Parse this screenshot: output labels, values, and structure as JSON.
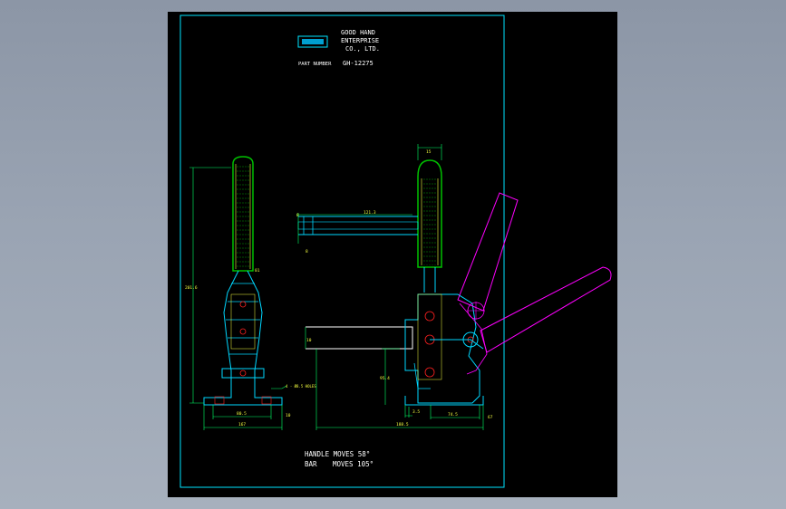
{
  "title_block": {
    "company_line1": "GOOD HAND",
    "company_line2": "ENTERPRISE",
    "company_line3": "CO., LTD.",
    "part_number_label": "PART NUMBER",
    "part_number": "GH-12275"
  },
  "dimensions": {
    "left_height": "201.6",
    "left_base_inner": "80.5",
    "left_base_outer": "167",
    "left_base_side": "10",
    "hole_note": "4 - Ø8.5 HOLES",
    "handle_width": "15",
    "bar_length": "121.3",
    "bar_left_top": "8",
    "bar_left_bottom": "8",
    "clamp_height": "95.4",
    "arm_offset": "10",
    "base_small": "3.5",
    "base_mid": "74.5",
    "base_right": "67",
    "overall_length": "188.5",
    "pivot_label": "01"
  },
  "notes": {
    "handle_moves": "HANDLE MOVES 58°",
    "bar_label": "BAR",
    "bar_moves": "MOVES 105°"
  },
  "colors": {
    "frame": "#00e5ff",
    "body": "#00d7ff",
    "rubber": "#00c000",
    "dimension": "#00ff66",
    "text": "#ffffff",
    "yellow": "#f5ff40",
    "alt_position": "#ff00ff",
    "red": "#ff2020",
    "sheet_bg": "#000000"
  }
}
